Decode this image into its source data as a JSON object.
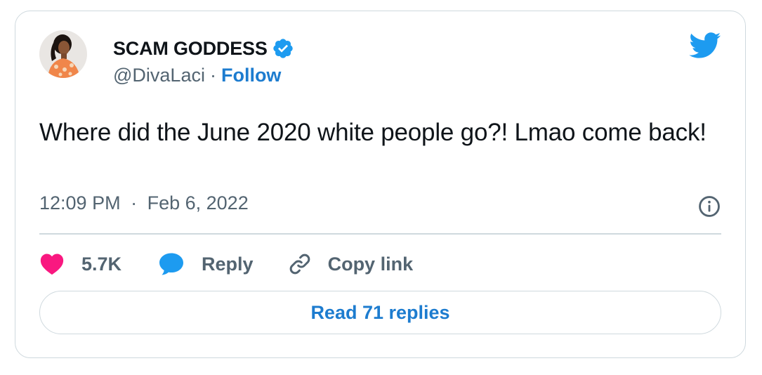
{
  "author": {
    "display_name": "SCAM GODDESS",
    "handle": "@DivaLaci",
    "separator": "·",
    "follow_label": "Follow"
  },
  "tweet": {
    "text": "Where did the June 2020 white people go?! Lmao come back!",
    "time": "12:09 PM",
    "separator": "·",
    "date": "Feb 6, 2022"
  },
  "actions": {
    "like_count": "5.7K",
    "reply_label": "Reply",
    "copy_label": "Copy link"
  },
  "read_replies_label": "Read 71 replies",
  "icons": {
    "brand": "twitter-bird-icon",
    "verified": "verified-badge-icon",
    "like": "heart-icon",
    "reply": "speech-bubble-icon",
    "copy": "link-icon",
    "info": "info-icon"
  },
  "colors": {
    "brand_blue": "#1d9bf0",
    "link_blue": "#1d7ccf",
    "like_pink": "#f91880",
    "text": "#0f1419",
    "muted": "#536471",
    "border": "#cfd9de"
  }
}
